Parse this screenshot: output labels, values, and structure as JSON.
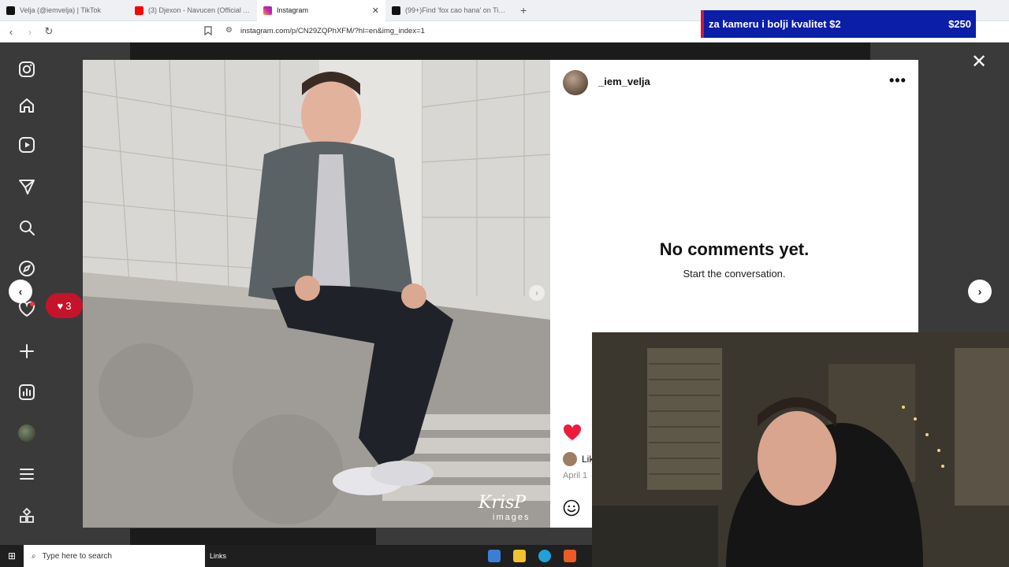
{
  "browser": {
    "tabs": [
      {
        "title": "Velja (@iemvelja) | TikTok",
        "icon": "tiktok-icon",
        "color": "#111111",
        "active": false
      },
      {
        "title": "(3) Djexon - Navucen (Official Anima",
        "icon": "youtube-icon",
        "color": "#ff0000",
        "active": false
      },
      {
        "title": "Instagram",
        "icon": "instagram-icon",
        "color": "#d6249f",
        "active": true
      },
      {
        "title": "(99+)Find 'fox cao hana' on TikTok |",
        "icon": "tiktok-icon",
        "color": "#111111",
        "active": false
      }
    ],
    "new_tab": "+",
    "url": "instagram.com/p/CN29ZQPhXFM/?hl=en&img_index=1"
  },
  "banner": {
    "text": "za kameru i bolji kvalitet  $2",
    "amount": "$250",
    "bg": "#0b1ea8"
  },
  "post": {
    "username": "_iem_velja",
    "more": "•••",
    "no_comments_title": "No comments yet.",
    "no_comments_sub": "Start the conversation.",
    "likes_fragment": "Lik",
    "date_fragment": "April 1",
    "watermark": "KrisP",
    "watermark_sub": "images",
    "like_color": "#ed1c3c"
  },
  "notification": {
    "count": "3"
  },
  "taskbar": {
    "search_placeholder": "Type here to search",
    "links_label": "Links"
  }
}
